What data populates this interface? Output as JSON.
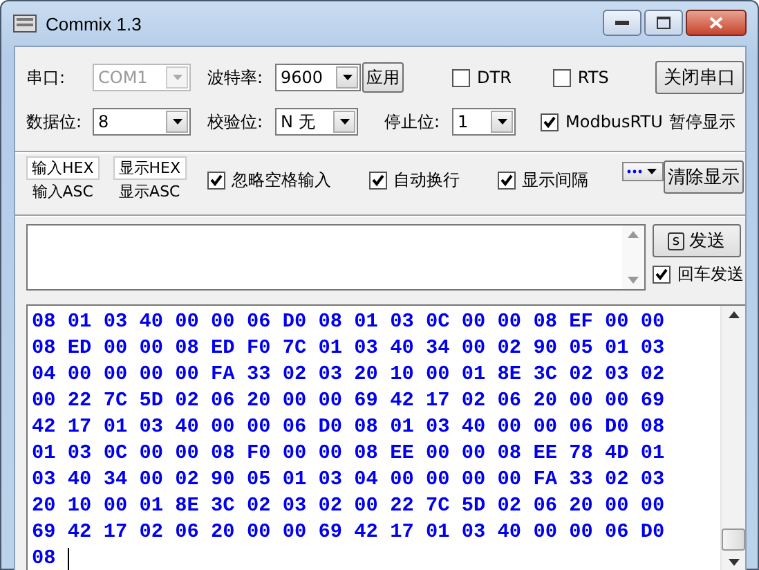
{
  "window": {
    "title": "Commix 1.3"
  },
  "port_row": {
    "serial_port": {
      "label": "串口:",
      "value": "COM1",
      "disabled": true
    },
    "baud_rate": {
      "label": "波特率:",
      "value": "9600"
    },
    "apply_button": "应用",
    "dtr": {
      "label": "DTR",
      "checked": false
    },
    "rts": {
      "label": "RTS",
      "checked": false
    },
    "close_port_button": "关闭串口"
  },
  "frame_row": {
    "data_bits": {
      "label": "数据位:",
      "value": "8"
    },
    "parity": {
      "label": "校验位:",
      "value": "N 无"
    },
    "stop_bits": {
      "label": "停止位:",
      "value": "1"
    },
    "modbus_rtu": {
      "label": "ModbusRTU",
      "checked": true
    },
    "pause_display_button": "暂停显示"
  },
  "display_options": {
    "input_mode": [
      {
        "label": "输入HEX",
        "selected": true
      },
      {
        "label": "输入ASC",
        "selected": false
      }
    ],
    "display_mode": [
      {
        "label": "显示HEX",
        "selected": true
      },
      {
        "label": "显示ASC",
        "selected": false
      }
    ],
    "checkboxes": [
      {
        "label": "忽略空格输入",
        "checked": true
      },
      {
        "label": "自动换行",
        "checked": true
      },
      {
        "label": "显示间隔",
        "checked": true
      }
    ],
    "clear_button": "清除显示"
  },
  "send": {
    "shortcut": "s",
    "button": "发送",
    "enter_send": {
      "label": "回车发送",
      "checked": true
    }
  },
  "output": {
    "lines": [
      "08 01 03 40 00 00 06 D0 08 01 03 0C 00 00 08 EF 00 00",
      "08 ED 00 00 08 ED F0 7C 01 03 40 34 00 02 90 05 01 03",
      "04 00 00 00 00 FA 33 02 03 20 10 00 01 8E 3C 02 03 02",
      "00 22 7C 5D 02 06 20 00 00 69 42 17 02 06 20 00 00 69",
      "42 17 01 03 40 00 00 06 D0 08 01 03 40 00 00 06 D0 08",
      "01 03 0C 00 00 08 F0 00 00 08 EE 00 00 08 EE 78 4D 01",
      "03 40 34 00 02 90 05 01 03 04 00 00 00 00 FA 33 02 03",
      "20 10 00 01 8E 3C 02 03 02 00 22 7C 5D 02 06 20 00 00",
      "69 42 17 02 06 20 00 00 69 42 17 01 03 40 00 00 06 D0",
      "08"
    ]
  }
}
